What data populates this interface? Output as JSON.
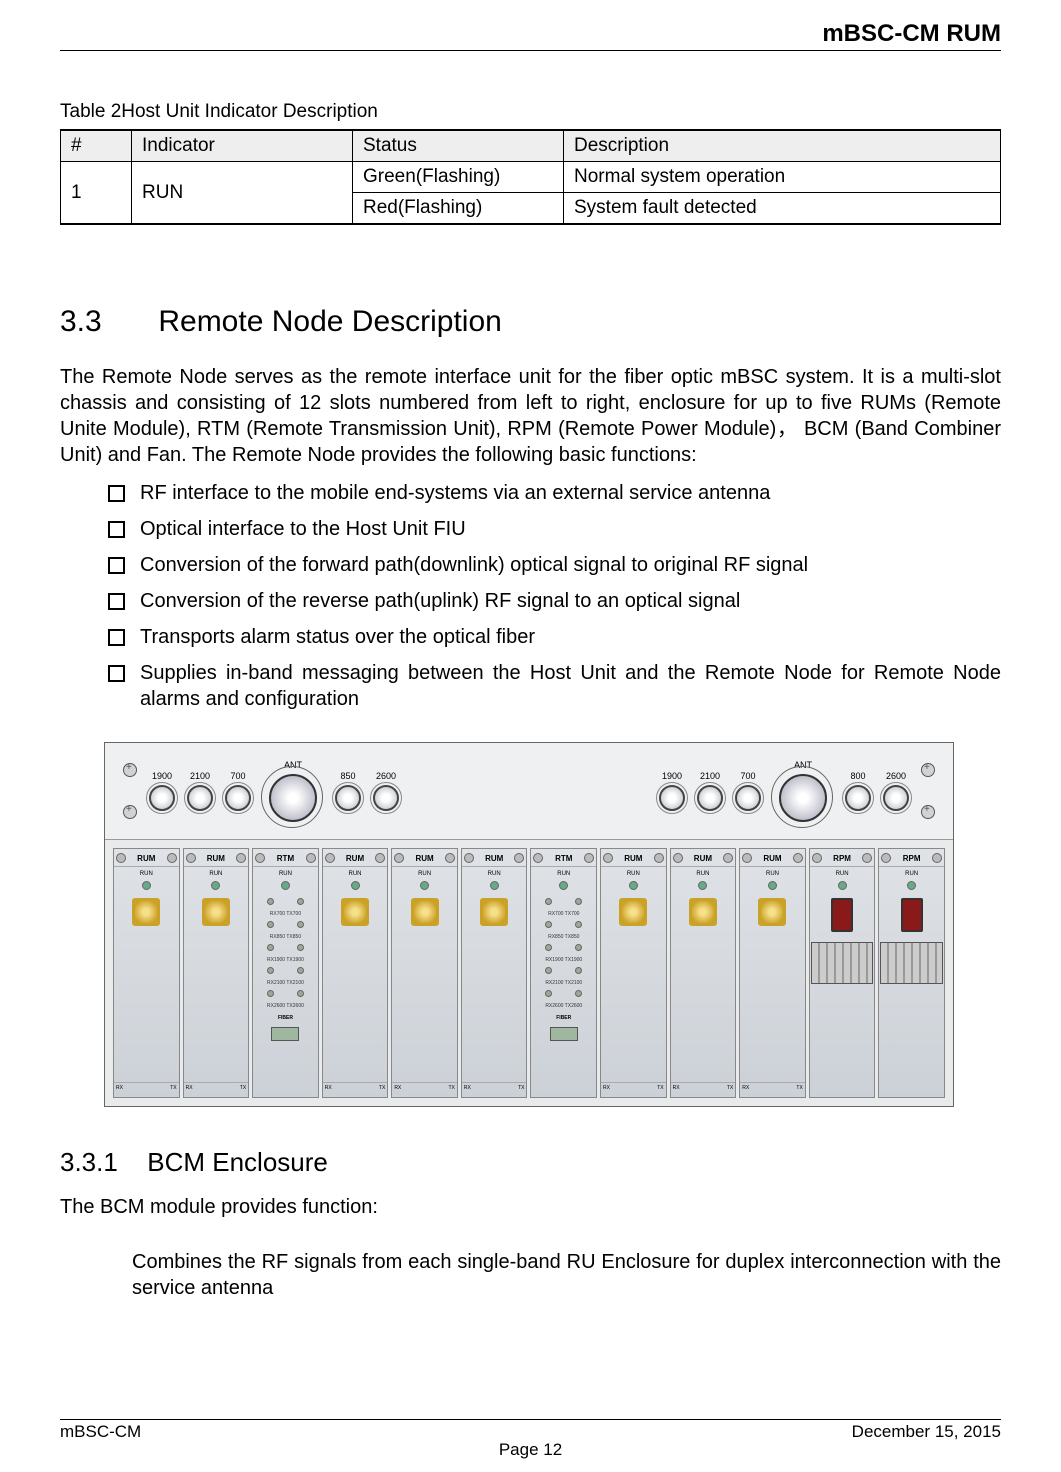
{
  "header": {
    "title": "mBSC-CM  RUM"
  },
  "table_caption": "Table 2Host Unit Indicator Description",
  "table": {
    "headers": {
      "num": "#",
      "indicator": "Indicator",
      "status": "Status",
      "description": "Description"
    },
    "rows": [
      {
        "num": "1",
        "indicator": "RUN",
        "status": "Green(Flashing)",
        "description": "Normal system operation"
      },
      {
        "num": "",
        "indicator": "",
        "status": "Red(Flashing)",
        "description": "System fault detected"
      }
    ]
  },
  "sec33": {
    "num": "3.3",
    "title": "Remote Node Description",
    "para": "The Remote Node serves as the remote interface unit for the fiber optic mBSC system. It is a multi-slot chassis and consisting of 12 slots numbered from left to right, enclosure for up to five RUMs (Remote Unite Module), RTM (Remote Transmission Unit), RPM (Remote Power Module)，  BCM (Band Combiner Unit) and Fan. The Remote Node provides the following basic functions:",
    "bullets": [
      "RF interface to the mobile end-systems via an external service antenna",
      "Optical interface to the Host Unit FIU",
      "Conversion of the forward path(downlink) optical signal to original RF signal",
      "Conversion of the reverse path(uplink) RF signal to an optical signal",
      "Transports alarm status over the optical fiber",
      "Supplies in-band messaging between the Host Unit and the Remote Node for Remote Node alarms and configuration"
    ]
  },
  "diagram": {
    "top_labels": [
      "1900",
      "2100",
      "700",
      "ANT",
      "850",
      "2600",
      "1900",
      "2100",
      "700",
      "ANT",
      "800",
      "2600"
    ],
    "slot_labels": [
      "RUM",
      "RUM",
      "RTM",
      "RUM",
      "RUM",
      "RUM",
      "RTM",
      "RUM",
      "RUM",
      "RUM",
      "RPM",
      "RPM"
    ],
    "run_text": "RUN",
    "fiber_text": "FIBER",
    "rtm_ports": [
      "RX700  TX700",
      "RX850  TX850",
      "RX1900  TX1900",
      "RX2100  TX2100",
      "RX2600  TX2600"
    ],
    "rxtx": {
      "rx": "RX",
      "tx": "TX"
    }
  },
  "sec331": {
    "num": "3.3.1",
    "title": "BCM Enclosure",
    "intro": "The BCM module provides function:",
    "body": "Combines the RF signals from each single-band RU Enclosure for duplex interconnection with the service antenna"
  },
  "footer": {
    "left": "mBSC-CM",
    "right": "December 15, 2015",
    "center": "Page 12"
  }
}
